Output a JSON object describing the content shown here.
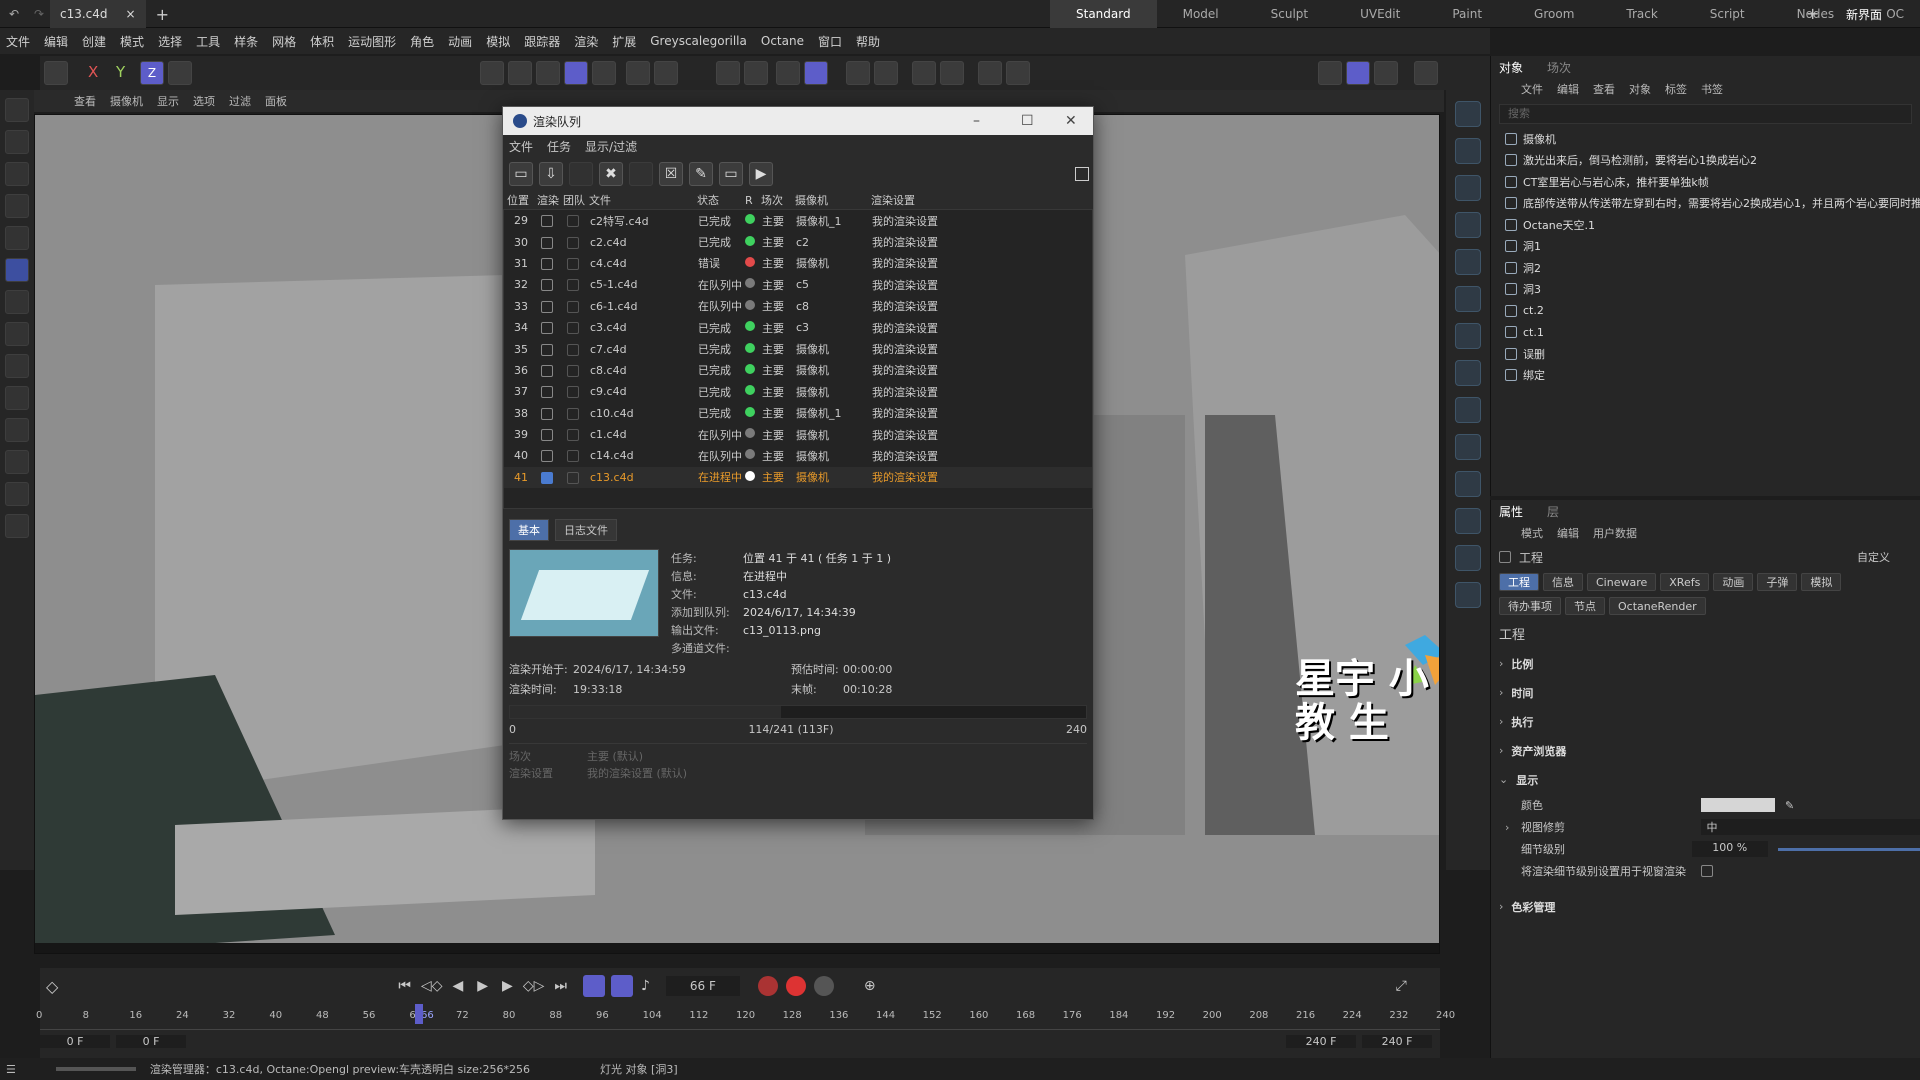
{
  "titlebar": {
    "tab_title": "c13.c4d",
    "tab_close": "×",
    "add_tab": "+",
    "layouts": [
      "Standard",
      "Model",
      "Sculpt",
      "UVEdit",
      "Paint",
      "Groom",
      "Track",
      "Script",
      "Nodes",
      "OC"
    ],
    "new_interface": "新界面"
  },
  "menubar": [
    "文件",
    "编辑",
    "创建",
    "模式",
    "选择",
    "工具",
    "样条",
    "网格",
    "体积",
    "运动图形",
    "角色",
    "动画",
    "模拟",
    "跟踪器",
    "渲染",
    "扩展",
    "Greyscalegorilla",
    "Octane",
    "窗口",
    "帮助"
  ],
  "coord_axes": {
    "x": "X",
    "y": "Y",
    "z": "Z"
  },
  "viewport_menu": [
    "查看",
    "摄像机",
    "显示",
    "选项",
    "过滤",
    "面板"
  ],
  "dialog": {
    "title": "渲染队列",
    "menu": [
      "文件",
      "任务",
      "显示/过滤"
    ],
    "columns": [
      "位置",
      "渲染",
      "团队",
      "文件",
      "状态",
      "R",
      "场次",
      "摄像机",
      "渲染设置"
    ],
    "rows": [
      {
        "pos": "29",
        "file": "c2特写.c4d",
        "status": "已完成",
        "color": "#3fd15f",
        "take": "主要",
        "camera": "摄像机_1",
        "settings": "我的渲染设置",
        "checked": false,
        "selected": false
      },
      {
        "pos": "30",
        "file": "c2.c4d",
        "status": "已完成",
        "color": "#3fd15f",
        "take": "主要",
        "camera": "c2",
        "settings": "我的渲染设置",
        "checked": false,
        "selected": false
      },
      {
        "pos": "31",
        "file": "c4.c4d",
        "status": "错误",
        "color": "#e24a4a",
        "take": "主要",
        "camera": "摄像机",
        "settings": "我的渲染设置",
        "checked": false,
        "selected": false
      },
      {
        "pos": "32",
        "file": "c5-1.c4d",
        "status": "在队列中",
        "color": "#7a7a7a",
        "take": "主要",
        "camera": "c5",
        "settings": "我的渲染设置",
        "checked": false,
        "selected": false
      },
      {
        "pos": "33",
        "file": "c6-1.c4d",
        "status": "在队列中",
        "color": "#7a7a7a",
        "take": "主要",
        "camera": "c8",
        "settings": "我的渲染设置",
        "checked": false,
        "selected": false
      },
      {
        "pos": "34",
        "file": "c3.c4d",
        "status": "已完成",
        "color": "#3fd15f",
        "take": "主要",
        "camera": "c3",
        "settings": "我的渲染设置",
        "checked": false,
        "selected": false
      },
      {
        "pos": "35",
        "file": "c7.c4d",
        "status": "已完成",
        "color": "#3fd15f",
        "take": "主要",
        "camera": "摄像机",
        "settings": "我的渲染设置",
        "checked": false,
        "selected": false
      },
      {
        "pos": "36",
        "file": "c8.c4d",
        "status": "已完成",
        "color": "#3fd15f",
        "take": "主要",
        "camera": "摄像机",
        "settings": "我的渲染设置",
        "checked": false,
        "selected": false
      },
      {
        "pos": "37",
        "file": "c9.c4d",
        "status": "已完成",
        "color": "#3fd15f",
        "take": "主要",
        "camera": "摄像机",
        "settings": "我的渲染设置",
        "checked": false,
        "selected": false
      },
      {
        "pos": "38",
        "file": "c10.c4d",
        "status": "已完成",
        "color": "#3fd15f",
        "take": "主要",
        "camera": "摄像机_1",
        "settings": "我的渲染设置",
        "checked": false,
        "selected": false
      },
      {
        "pos": "39",
        "file": "c1.c4d",
        "status": "在队列中",
        "color": "#7a7a7a",
        "take": "主要",
        "camera": "摄像机",
        "settings": "我的渲染设置",
        "checked": false,
        "selected": false
      },
      {
        "pos": "40",
        "file": "c14.c4d",
        "status": "在队列中",
        "color": "#7a7a7a",
        "take": "主要",
        "camera": "摄像机",
        "settings": "我的渲染设置",
        "checked": false,
        "selected": false
      },
      {
        "pos": "41",
        "file": "c13.c4d",
        "status": "在进程中",
        "color": "#ffffff",
        "take": "主要",
        "camera": "摄像机",
        "settings": "我的渲染设置",
        "checked": true,
        "selected": true
      }
    ],
    "detail_tabs": [
      "基本",
      "日志文件"
    ],
    "details": [
      {
        "label": "任务:",
        "value": "位置 41 于 41 ( 任务 1 于 1 )"
      },
      {
        "label": "信息:",
        "value": "在进程中"
      },
      {
        "label": "文件:",
        "value": "c13.c4d"
      },
      {
        "label": "添加到队列:",
        "value": "2024/6/17, 14:34:39"
      },
      {
        "label": "输出文件:",
        "value": "c13_0113.png"
      },
      {
        "label": "多通道文件:",
        "value": ""
      }
    ],
    "render_start_label": "渲染开始于:",
    "render_start": "2024/6/17, 14:34:59",
    "render_time_label": "渲染时间:",
    "render_time": "19:33:18",
    "estimate_label": "预估时间:",
    "estimate": "00:00:00",
    "final_label": "末帧:",
    "final": "00:10:28",
    "progress_fraction": 0.47,
    "progress_min": "0",
    "progress_text": "114/241 (113F)",
    "progress_max": "240",
    "take_label": "场次",
    "take_value": "主要 (默认)",
    "settings_label": "渲染设置",
    "settings_value": "我的渲染设置 (默认)"
  },
  "object_panel": {
    "tabs": [
      "对象",
      "场次"
    ],
    "menu": [
      "文件",
      "编辑",
      "查看",
      "对象",
      "标签",
      "书签"
    ],
    "search_placeholder": "搜索",
    "items": [
      "摄像机",
      "激光出来后，倒马检测前，要将岩心1换成岩心2",
      "CT室里岩心与岩心床，推杆要单独k帧",
      "底部传送带从传送带左穿到右时，需要将岩心2换成岩心1，并且两个岩心要同时推",
      "Octane天空.1",
      "洞1",
      "洞2",
      "洞3",
      "ct.2",
      "ct.1",
      "误删",
      "绑定"
    ]
  },
  "attr_panel": {
    "tabs": [
      "属性",
      "层"
    ],
    "menu": [
      "模式",
      "编辑",
      "用户数据"
    ],
    "project_label": "工程",
    "custom_label": "自定义",
    "buttons_row1": [
      "工程",
      "信息",
      "Cineware",
      "XRefs",
      "动画",
      "子弹",
      "模拟"
    ],
    "buttons_row2": [
      "待办事项",
      "节点",
      "OctaneRender"
    ],
    "section_title": "工程",
    "sections": [
      "比例",
      "时间",
      "执行",
      "资产浏览器",
      "显示"
    ],
    "display_color_label": "颜色",
    "viewport_clip_label": "视图修剪",
    "viewport_clip_value": "中",
    "lod_label": "细节级别",
    "lod_value": "100 %",
    "render_lod_label": "将渲染细节级别设置用于视窗渲染",
    "color_mgmt": "色彩管理"
  },
  "timeline": {
    "current_frame": "66 F",
    "ticks": [
      "0",
      "8",
      "16",
      "24",
      "32",
      "40",
      "48",
      "56",
      "64",
      "66",
      "72",
      "80",
      "88",
      "96",
      "104",
      "112",
      "120",
      "128",
      "136",
      "144",
      "152",
      "160",
      "168",
      "176",
      "184",
      "192",
      "200",
      "208",
      "216",
      "224",
      "232",
      "240"
    ],
    "start_a": "0 F",
    "start_b": "0 F",
    "end_a": "240 F",
    "end_b": "240 F"
  },
  "statusbar": {
    "text": "渲染管理器：c13.c4d, Octane:Opengl preview:车壳透明白  size:256*256",
    "object_info": "灯光 对象 [洞3]"
  },
  "watermark": "星宇 小教 生"
}
